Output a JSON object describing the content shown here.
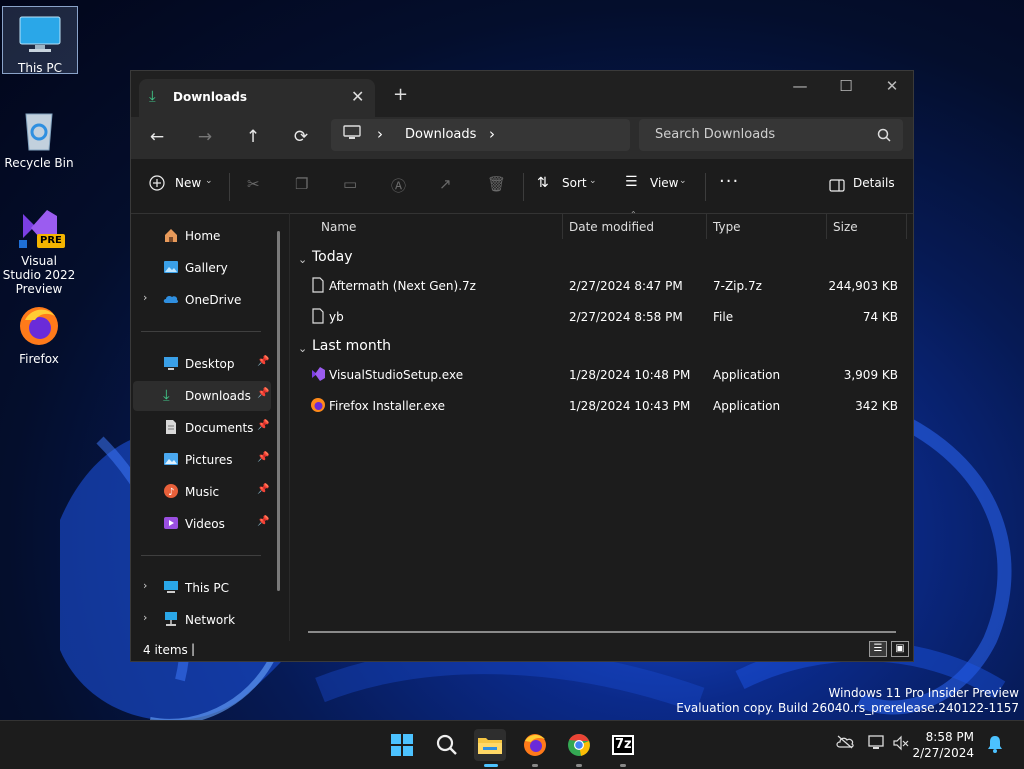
{
  "desktop": {
    "icons": [
      {
        "label": "This PC"
      },
      {
        "label": "Recycle Bin"
      },
      {
        "label": "Visual Studio 2022 Preview",
        "badge": "PRE"
      },
      {
        "label": "Firefox"
      }
    ]
  },
  "window": {
    "tab_title": "Downloads",
    "tab_close": "✕",
    "new_tab": "+",
    "caption": {
      "minimize": "—",
      "maximize": "☐",
      "close": "✕"
    },
    "nav": {
      "back": "←",
      "forward": "→",
      "up": "↑",
      "refresh": "⟳"
    },
    "address": {
      "separator": "›",
      "current": "Downloads"
    },
    "search_placeholder": "Search Downloads",
    "commands": {
      "new": "New",
      "sort": "Sort",
      "view": "View",
      "more": "···",
      "details": "Details"
    },
    "nav_pane": [
      {
        "label": "Home",
        "icon": "home-icon"
      },
      {
        "label": "Gallery",
        "icon": "gallery-icon"
      },
      {
        "label": "OneDrive",
        "icon": "onedrive-icon",
        "expandable": true
      },
      {
        "label": "Desktop",
        "icon": "desktop-icon",
        "pinned": true
      },
      {
        "label": "Downloads",
        "icon": "downloads-icon",
        "pinned": true,
        "selected": true
      },
      {
        "label": "Documents",
        "icon": "documents-icon",
        "pinned": true
      },
      {
        "label": "Pictures",
        "icon": "pictures-icon",
        "pinned": true
      },
      {
        "label": "Music",
        "icon": "music-icon",
        "pinned": true
      },
      {
        "label": "Videos",
        "icon": "videos-icon",
        "pinned": true
      },
      {
        "label": "This PC",
        "icon": "this-pc-icon",
        "expandable": true
      },
      {
        "label": "Network",
        "icon": "network-icon",
        "expandable": true
      }
    ],
    "columns": {
      "name": "Name",
      "date": "Date modified",
      "type": "Type",
      "size": "Size"
    },
    "groups": [
      {
        "label": "Today",
        "files": [
          {
            "name": "Aftermath (Next Gen).7z",
            "date": "2/27/2024 8:47 PM",
            "type": "7-Zip.7z",
            "size": "244,903 KB",
            "icon": "file-icon"
          },
          {
            "name": "yb",
            "date": "2/27/2024 8:58 PM",
            "type": "File",
            "size": "74 KB",
            "icon": "file-icon"
          }
        ]
      },
      {
        "label": "Last month",
        "files": [
          {
            "name": "VisualStudioSetup.exe",
            "date": "1/28/2024 10:48 PM",
            "type": "Application",
            "size": "3,909 KB",
            "icon": "visual-studio-icon"
          },
          {
            "name": "Firefox Installer.exe",
            "date": "1/28/2024 10:43 PM",
            "type": "Application",
            "size": "342 KB",
            "icon": "firefox-installer-icon"
          }
        ]
      }
    ],
    "status": "4 items"
  },
  "watermark": {
    "line1": "Windows 11 Pro Insider Preview",
    "line2": "Evaluation copy. Build 26040.rs_prerelease.240122-1157"
  },
  "taskbar": {
    "apps": [
      "start-icon",
      "search-icon",
      "file-explorer-icon",
      "firefox-icon",
      "chrome-icon",
      "7zip-icon"
    ],
    "time": "8:58 PM",
    "date": "2/27/2024",
    "sevenzip_label": "7z"
  },
  "colors": {
    "accent": "#4cc2ff",
    "folder": "#f5c542",
    "window_bg": "#1c1c1c"
  }
}
